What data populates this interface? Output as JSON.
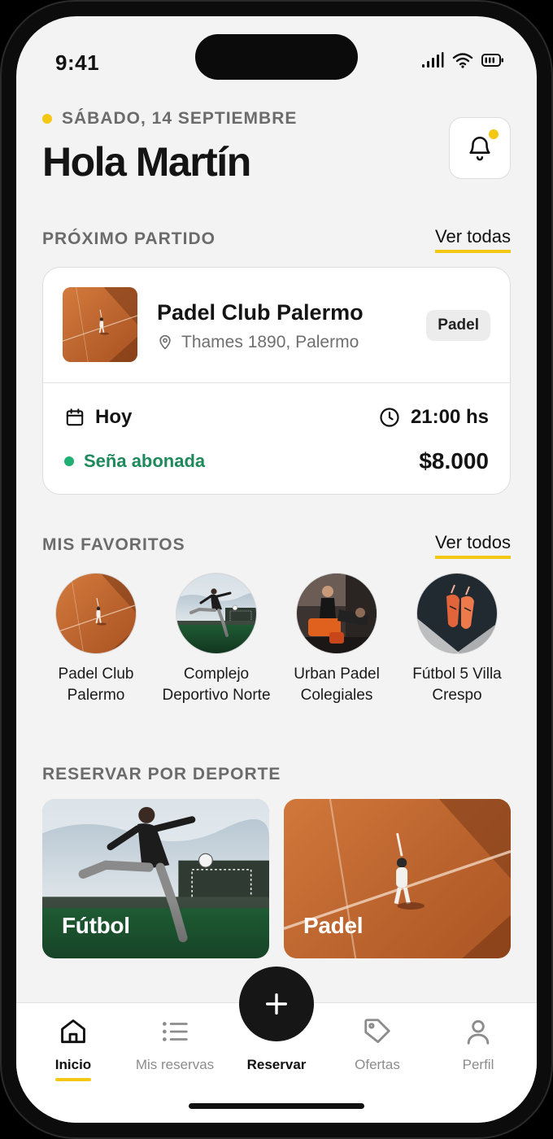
{
  "status_bar": {
    "time": "9:41"
  },
  "header": {
    "date": "SÁBADO, 14 SEPTIEMBRE",
    "greeting": "Hola Martín",
    "accent_color": "#f3c712"
  },
  "next_match": {
    "section_title": "PRÓXIMO PARTIDO",
    "see_all_label": "Ver todas",
    "venue": "Padel Club Palermo",
    "address": "Thames 1890, Palermo",
    "sport": "Padel",
    "day": "Hoy",
    "time": "21:00 hs",
    "payment_status": "Seña abonada",
    "price": "$8.000",
    "status_color": "#1e8a5b"
  },
  "favorites": {
    "section_title": "MIS FAVORITOS",
    "see_all_label": "Ver todos",
    "items": [
      {
        "name": "Padel Club Palermo",
        "image": "padel-court"
      },
      {
        "name": "Complejo Deportivo Norte",
        "image": "football-kick"
      },
      {
        "name": "Urban Padel Colegiales",
        "image": "gym-training"
      },
      {
        "name": "Fútbol 5 Villa Crespo",
        "image": "football-boots"
      }
    ]
  },
  "sports": {
    "section_title": "RESERVAR POR DEPORTE",
    "items": [
      {
        "label": "Fútbol",
        "image": "football-kick"
      },
      {
        "label": "Padel",
        "image": "padel-court"
      }
    ]
  },
  "nav": {
    "items": [
      {
        "label": "Inicio",
        "icon": "home-icon",
        "active": true
      },
      {
        "label": "Mis reservas",
        "icon": "list-icon",
        "active": false
      },
      {
        "label": "Reservar",
        "icon": "plus-icon",
        "active": false
      },
      {
        "label": "Ofertas",
        "icon": "tag-icon",
        "active": false
      },
      {
        "label": "Perfil",
        "icon": "user-icon",
        "active": false
      }
    ]
  }
}
